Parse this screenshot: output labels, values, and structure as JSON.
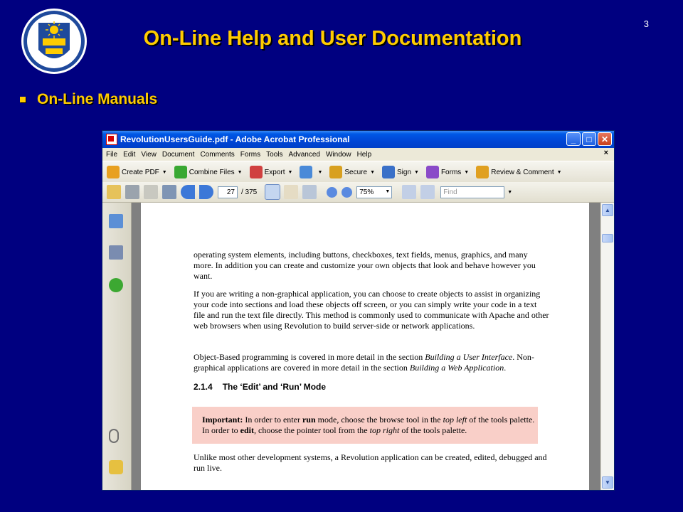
{
  "slide": {
    "title": "On-Line Help and User Documentation",
    "number": "3",
    "bullet": "On-Line Manuals"
  },
  "window": {
    "title": "RevolutionUsersGuide.pdf - Adobe Acrobat Professional",
    "controls": {
      "minimize": "_",
      "maximize": "□",
      "close": "✕"
    },
    "menu": [
      "File",
      "Edit",
      "View",
      "Document",
      "Comments",
      "Forms",
      "Tools",
      "Advanced",
      "Window",
      "Help"
    ],
    "doc_close": "×",
    "toolbar1": [
      {
        "label": "Create PDF",
        "icon": "create-pdf-icon",
        "color": "#e8a020"
      },
      {
        "label": "Combine Files",
        "icon": "combine-files-icon",
        "color": "#39a832"
      },
      {
        "label": "Export",
        "icon": "export-icon",
        "color": "#d04040"
      },
      {
        "label": "",
        "icon": "print-export-icon",
        "color": "#4a8ad8"
      },
      {
        "label": "Secure",
        "icon": "lock-icon",
        "color": "#d8a020"
      },
      {
        "label": "Sign",
        "icon": "pen-icon",
        "color": "#3a70c8"
      },
      {
        "label": "Forms",
        "icon": "forms-icon",
        "color": "#8a4ac8"
      },
      {
        "label": "Review & Comment",
        "icon": "review-icon",
        "color": "#e0a020"
      }
    ],
    "toolbar2": {
      "page_current": "27",
      "page_total": "/ 375",
      "zoom": "75%",
      "find_placeholder": "Find"
    }
  },
  "document": {
    "para1": "operating system elements, including buttons, checkboxes, text fields, menus, graphics, and many more. In addition you can create and customize your own objects that look and behave however you want.",
    "para2": "If you are writing a non-graphical application, you can choose to create objects to assist in organizing your code into sections and load these objects off screen, or you can simply write your code in a text file and run the text file directly. This method is commonly used to communicate with Apache and other web browsers when using Revolution to build server-side or network applications.",
    "para3_a": "Object-Based programming is covered in more detail in the section ",
    "para3_b": "Building a User Interface",
    "para3_c": ". Non-graphical applications are covered in more detail in the section ",
    "para3_d": "Building a Web Application",
    "para3_e": ".",
    "heading_num": "2.1.4",
    "heading_text": "The ‘Edit’ and ‘Run’ Mode",
    "note": {
      "label": "Important:",
      "t1": " In order to enter ",
      "run": "run",
      "t2": " mode, choose the browse tool in the ",
      "top_left": "top left",
      "t3": " of the tools palette. In order to ",
      "edit": "edit",
      "t4": ", choose the pointer tool from the ",
      "top_right": "top right",
      "t5": " of the tools palette."
    },
    "para4": "Unlike most other development systems, a Revolution application can be created, edited, debugged and run live."
  },
  "colors": {
    "slide_bg": "#000080",
    "title": "#ffcc00",
    "note_bg": "#f9cfc8"
  }
}
